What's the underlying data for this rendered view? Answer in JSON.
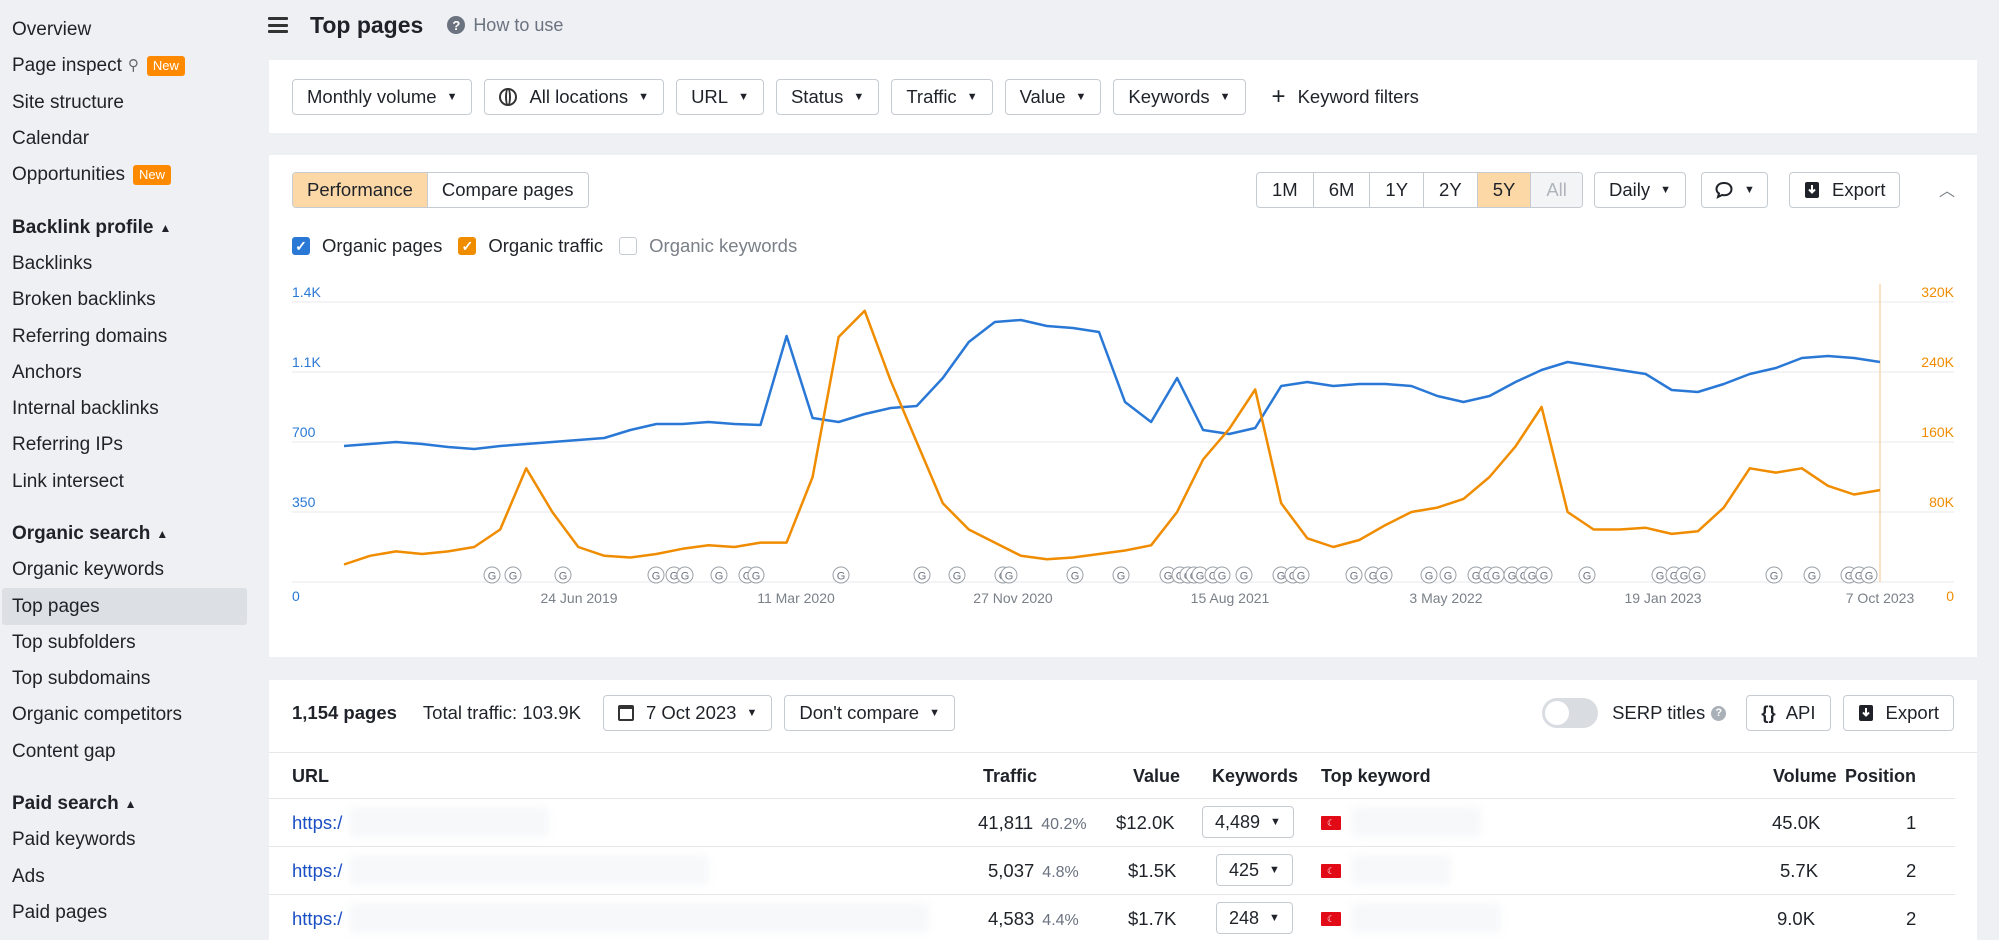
{
  "sidebar": {
    "top_items": [
      {
        "label": "Overview"
      },
      {
        "label": "Page inspect",
        "badge": "New",
        "search": true
      },
      {
        "label": "Site structure"
      },
      {
        "label": "Calendar"
      },
      {
        "label": "Opportunities",
        "badge": "New"
      }
    ],
    "backlink_heading": "Backlink profile",
    "backlink_items": [
      "Backlinks",
      "Broken backlinks",
      "Referring domains",
      "Anchors",
      "Internal backlinks",
      "Referring IPs",
      "Link intersect"
    ],
    "organic_heading": "Organic search",
    "organic_items": [
      "Organic keywords",
      "Top pages",
      "Top subfolders",
      "Top subdomains",
      "Organic competitors",
      "Content gap"
    ],
    "paid_heading": "Paid search",
    "paid_items": [
      "Paid keywords",
      "Ads",
      "Paid pages"
    ],
    "active_item": "Top pages"
  },
  "header": {
    "title": "Top pages",
    "how_to_use": "How to use"
  },
  "filters": {
    "monthly_volume": "Monthly volume",
    "locations": "All locations",
    "url": "URL",
    "status": "Status",
    "traffic": "Traffic",
    "value": "Value",
    "keywords": "Keywords",
    "keyword_filters": "Keyword filters"
  },
  "chart_controls": {
    "tabs": [
      "Performance",
      "Compare pages"
    ],
    "active_tab": "Performance",
    "ranges": [
      "1M",
      "6M",
      "1Y",
      "2Y",
      "5Y",
      "All"
    ],
    "active_range": "5Y",
    "disabled_range": "All",
    "interval": "Daily",
    "export": "Export",
    "checkboxes": [
      {
        "label": "Organic pages",
        "checked": true,
        "color": "#2a78d6"
      },
      {
        "label": "Organic traffic",
        "checked": true,
        "color": "#f08c00"
      },
      {
        "label": "Organic keywords",
        "checked": false
      }
    ]
  },
  "chart_data": {
    "type": "line",
    "x_tick_labels": [
      "24 Jun 2019",
      "11 Mar 2020",
      "27 Nov 2020",
      "15 Aug 2021",
      "3 May 2022",
      "19 Jan 2023",
      "7 Oct 2023"
    ],
    "y_left_ticks": [
      "0",
      "350",
      "700",
      "1.1K",
      "1.4K"
    ],
    "y_right_ticks": [
      "0",
      "80K",
      "160K",
      "240K",
      "320K"
    ],
    "y_left_lim": [
      0,
      1400
    ],
    "y_right_lim": [
      0,
      320000
    ],
    "grid": true,
    "series": [
      {
        "name": "Organic pages",
        "axis": "left",
        "color": "#2a78d6",
        "values": [
          680,
          690,
          700,
          690,
          675,
          665,
          680,
          690,
          700,
          710,
          720,
          760,
          790,
          790,
          800,
          790,
          785,
          1230,
          820,
          800,
          840,
          870,
          880,
          1020,
          1200,
          1300,
          1310,
          1280,
          1270,
          1250,
          900,
          800,
          1020,
          760,
          740,
          770,
          980,
          1000,
          980,
          990,
          990,
          980,
          930,
          900,
          930,
          1000,
          1060,
          1100,
          1080,
          1060,
          1040,
          960,
          950,
          990,
          1040,
          1070,
          1120,
          1130,
          1120,
          1100
        ]
      },
      {
        "name": "Organic traffic",
        "axis": "right",
        "color": "#f08c00",
        "values": [
          20000,
          30000,
          35000,
          32000,
          35000,
          40000,
          60000,
          130000,
          80000,
          40000,
          30000,
          28000,
          32000,
          38000,
          42000,
          40000,
          45000,
          45000,
          120000,
          280000,
          310000,
          230000,
          160000,
          90000,
          60000,
          45000,
          30000,
          26000,
          28000,
          32000,
          36000,
          42000,
          80000,
          140000,
          175000,
          220000,
          90000,
          50000,
          40000,
          48000,
          65000,
          80000,
          85000,
          95000,
          120000,
          155000,
          200000,
          80000,
          60000,
          60000,
          62000,
          55000,
          58000,
          85000,
          130000,
          125000,
          130000,
          110000,
          100000,
          105000
        ]
      }
    ]
  },
  "table_toolbar": {
    "count": "1,154 pages",
    "total_traffic": "Total traffic: 103.9K",
    "date": "7 Oct 2023",
    "compare": "Don't compare",
    "serp_titles": "SERP titles",
    "api": "API",
    "export": "Export"
  },
  "table": {
    "headers": [
      "URL",
      "Traffic",
      "Value",
      "Keywords",
      "Top keyword",
      "Volume",
      "Position"
    ],
    "rows": [
      {
        "url": "https:/",
        "traffic": "41,811",
        "traffic_pct": "40.2%",
        "value": "$12.0K",
        "keywords": "4,489",
        "volume": "45.0K",
        "position": "1"
      },
      {
        "url": "https:/",
        "traffic": "5,037",
        "traffic_pct": "4.8%",
        "value": "$1.5K",
        "keywords": "425",
        "volume": "5.7K",
        "position": "2"
      },
      {
        "url": "https:/",
        "traffic": "4,583",
        "traffic_pct": "4.4%",
        "value": "$1.7K",
        "keywords": "248",
        "volume": "9.0K",
        "position": "2"
      }
    ]
  }
}
